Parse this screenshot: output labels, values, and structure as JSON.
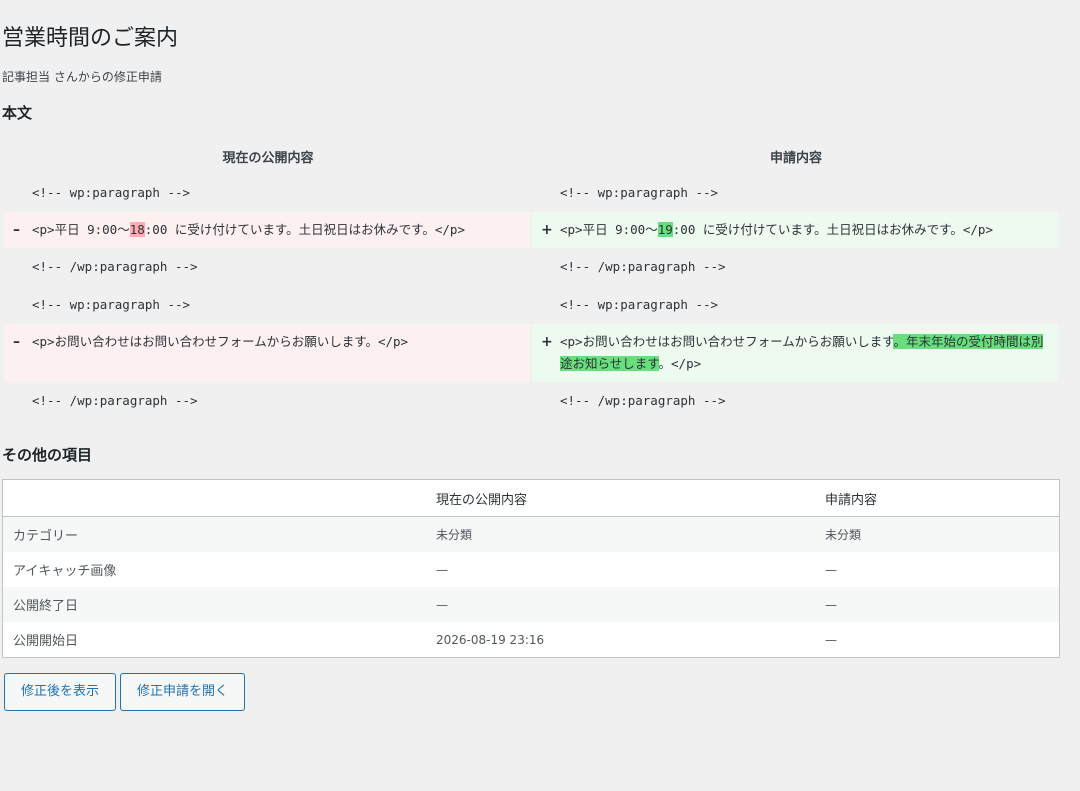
{
  "page": {
    "title": "営業時間のご案内",
    "subtitle": "記事担当 さんからの修正申請"
  },
  "body_section": {
    "heading": "本文",
    "col_current": "現在の公開内容",
    "col_request": "申請内容"
  },
  "diff": {
    "line1": "<!-- wp:paragraph -->",
    "line2_left_pre": "<p>平日 9:00〜",
    "line2_left_hl": "18",
    "line2_left_post": ":00 に受け付けています。土日祝日はお休みです。</p>",
    "line2_right_pre": "<p>平日 9:00〜",
    "line2_right_hl": "19",
    "line2_right_post": ":00 に受け付けています。土日祝日はお休みです。</p>",
    "line3": "<!-- /wp:paragraph -->",
    "line4": "<!-- wp:paragraph -->",
    "line5_left": "<p>お問い合わせはお問い合わせフォームからお願いします。</p>",
    "line5_right_pre": "<p>お問い合わせはお問い合わせフォームからお願いします",
    "line5_right_hl": "。年末年始の受付時間は別途お知らせします",
    "line5_right_post": "。</p>",
    "line6": "<!-- /wp:paragraph -->",
    "minus": "–",
    "plus": "+"
  },
  "other_section": {
    "heading": "その他の項目",
    "headers": [
      "",
      "現在の公開内容",
      "申請内容"
    ],
    "rows": [
      {
        "label": "カテゴリー",
        "current": "未分類",
        "request": "未分類"
      },
      {
        "label": "アイキャッチ画像",
        "current": "—",
        "request": "—"
      },
      {
        "label": "公開終了日",
        "current": "—",
        "request": "—"
      },
      {
        "label": "公開開始日",
        "current": "2026-08-19 23:16",
        "request": "—"
      }
    ]
  },
  "buttons": {
    "view_revised": "修正後を表示",
    "open_request": "修正申請を開く"
  },
  "colors": {
    "background": "#f0f0f1",
    "deleted_bg": "#fcf0f1",
    "deleted_highlight": "#ffabaf",
    "inserted_bg": "#edfaef",
    "inserted_highlight": "#68de7c",
    "accent": "#2271b1"
  }
}
